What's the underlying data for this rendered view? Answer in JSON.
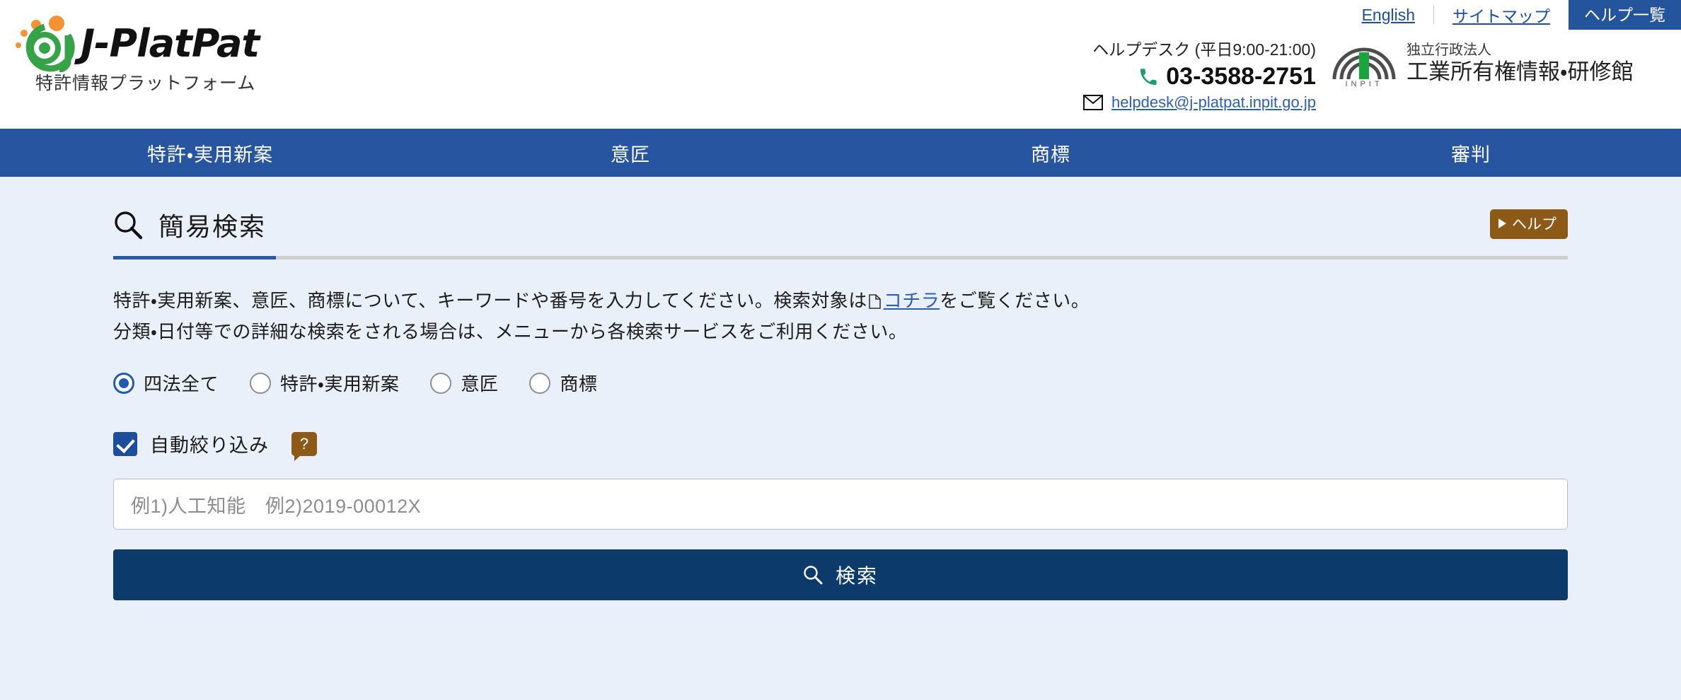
{
  "header": {
    "logo": {
      "wordmark": "J-PlatPat",
      "subtitle": "特許情報プラットフォーム",
      "mark_icon": "jplatpat-spiral-logo"
    },
    "top_links": [
      {
        "label": "English",
        "name": "english-link"
      },
      {
        "label": "サイトマップ",
        "name": "sitemap-link"
      }
    ],
    "help_list_button": "ヘルプ一覧",
    "helpdesk": {
      "title": "ヘルプデスク (平日9:00-21:00)",
      "phone": "03-3588-2751",
      "email": "helpdesk@j-platpat.inpit.go.jp",
      "phone_icon": "phone-icon",
      "mail_icon": "mail-icon"
    },
    "inpit": {
      "mark_label": "INPIT",
      "line1": "独立行政法人",
      "line2": "工業所有権情報・研修館"
    }
  },
  "nav": {
    "items": [
      {
        "label": "特許・実用新案",
        "name": "nav-patent-utility"
      },
      {
        "label": "意匠",
        "name": "nav-design"
      },
      {
        "label": "商標",
        "name": "nav-trademark"
      },
      {
        "label": "審判",
        "name": "nav-trial"
      }
    ]
  },
  "main": {
    "page_title": "簡易検索",
    "title_icon": "search-icon",
    "help_button": "ヘルプ",
    "description": {
      "line1_before": "特許・実用新案、意匠、商標について、キーワードや番号を入力してください。検索対象は",
      "line1_link": "コチラ",
      "line1_after": "をご覧ください。",
      "line2": "分類・日付等での詳細な検索をされる場合は、メニューから各検索サービスをご利用ください。"
    },
    "radio_group": {
      "options": [
        {
          "label": "四法全て",
          "checked": true,
          "name": "radio-all-four-laws"
        },
        {
          "label": "特許・実用新案",
          "checked": false,
          "name": "radio-patent-utility"
        },
        {
          "label": "意匠",
          "checked": false,
          "name": "radio-design"
        },
        {
          "label": "商標",
          "checked": false,
          "name": "radio-trademark"
        }
      ]
    },
    "auto_narrow": {
      "label": "自動絞り込み",
      "checked": true,
      "help_glyph": "?"
    },
    "search_input": {
      "value": "",
      "placeholder": "例1)人工知能　例2)2019-00012X"
    },
    "search_button": {
      "label": "検索",
      "icon": "search-icon"
    }
  },
  "colors": {
    "nav_blue": "#27559f",
    "main_bg": "#e9f0fa",
    "accent_link": "#2b5fb5",
    "brown_help": "#8c5a16",
    "search_button": "#0b3a6b",
    "logo_green": "#37a348",
    "logo_orange": "#f39333"
  }
}
